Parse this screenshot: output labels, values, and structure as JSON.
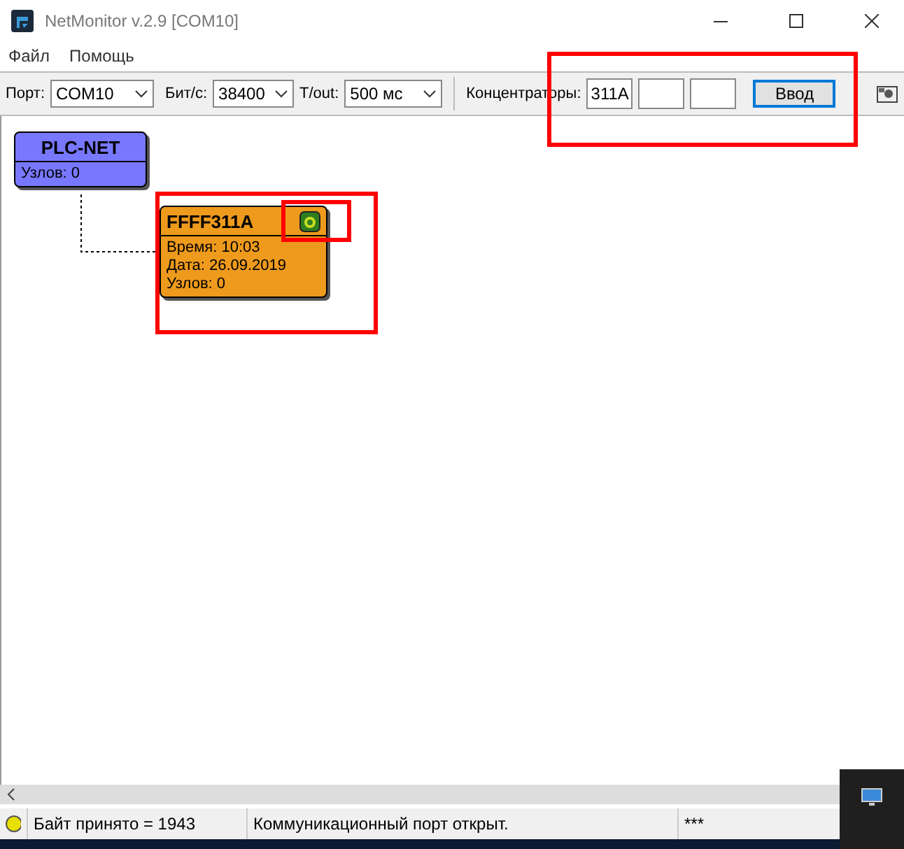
{
  "window": {
    "title": "NetMonitor v.2.9 [COM10]"
  },
  "menu": [
    {
      "label": "Файл"
    },
    {
      "label": "Помощь"
    }
  ],
  "toolbar": {
    "port_label": "Порт:",
    "port": "COM10",
    "baud_label": "Бит/с:",
    "baud": "38400",
    "timeout_label": "T/out:",
    "timeout": "500 мс",
    "hubs_label": "Концентраторы:",
    "hub_fields": [
      {
        "kind": "text",
        "value": "311A"
      },
      {
        "kind": "blank"
      },
      {
        "kind": "blank"
      }
    ],
    "enter_button": {
      "label": "Ввод",
      "focused": true
    }
  },
  "nodes": [
    {
      "kind": "root",
      "title": "PLC-NET",
      "color": "#7878ff",
      "lines": [
        "Узлов: 0"
      ]
    },
    {
      "kind": "hub",
      "title": "FFFF311A",
      "color": "#ee9a1c",
      "lines": [
        "Время: 10:03",
        "Дата: 26.09.2019",
        "Узлов: 0"
      ]
    }
  ],
  "annotations": [
    {
      "kind": "frame"
    },
    {
      "kind": "frame"
    },
    {
      "kind": "frame"
    }
  ],
  "status_bar": {
    "led": {
      "on": true
    },
    "bytes": "Байт принято = 1943",
    "message": "Коммуникационный порт открыт.",
    "extra": "***"
  }
}
